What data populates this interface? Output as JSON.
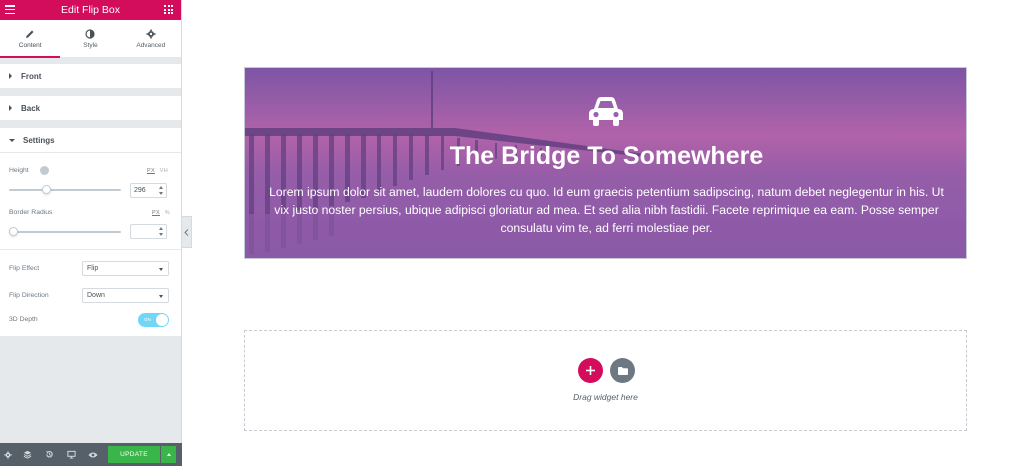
{
  "panel": {
    "title": "Edit Flip Box",
    "tabs": [
      {
        "label": "Content",
        "icon": "pencil-icon"
      },
      {
        "label": "Style",
        "icon": "contrast-icon"
      },
      {
        "label": "Advanced",
        "icon": "gear-icon"
      }
    ],
    "sections": {
      "front": "Front",
      "back": "Back",
      "settings": "Settings"
    },
    "height": {
      "label": "Height",
      "value": "296",
      "unit_active": "PX",
      "unit_other": "VH",
      "slider_level": 0.3
    },
    "border_radius": {
      "label": "Border Radius",
      "value": "",
      "unit_active": "PX",
      "unit_other": "%",
      "slider_level": 0
    },
    "flip_effect": {
      "label": "Flip Effect",
      "value": "Flip"
    },
    "flip_direction": {
      "label": "Flip Direction",
      "value": "Down"
    },
    "depth_3d": {
      "label": "3D Depth",
      "toggle_text": "ON",
      "on": true
    }
  },
  "footer": {
    "update_label": "UPDATE",
    "icons": [
      "settings-icon",
      "layers-icon",
      "history-icon",
      "responsive-icon",
      "preview-icon"
    ]
  },
  "flipbox": {
    "icon": "car-icon",
    "title": "The Bridge To Somewhere",
    "description": "Lorem ipsum dolor sit amet, laudem dolores cu quo. Id eum graecis petentium sadipscing, natum debet neglegentur in his. Ut vix justo noster persius, ubique adipisci gloriatur ad mea. Et sed alia nibh fastidii. Facete reprimique ea eam. Posse semper consulatu vim te, ad ferri molestiae per."
  },
  "dropzone": {
    "text": "Drag widget here"
  },
  "colors": {
    "brand": "#d30c5c",
    "update": "#39b54a",
    "toggle_on": "#71d7f7"
  }
}
